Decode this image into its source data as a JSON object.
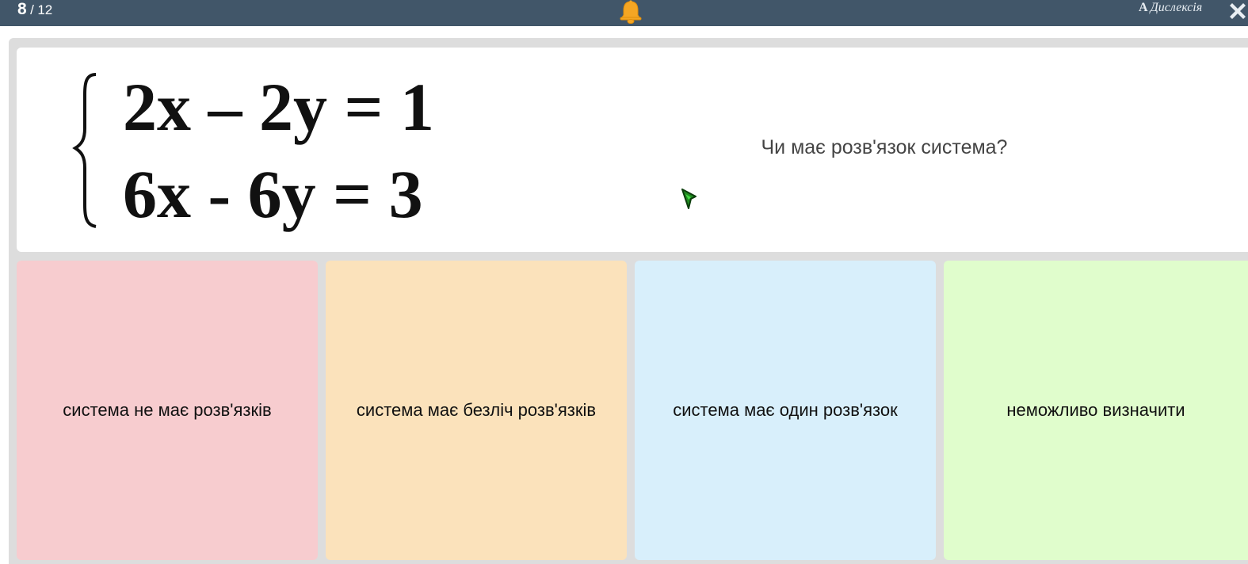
{
  "header": {
    "question_current": "8",
    "question_separator": "/",
    "question_total": "12",
    "dyslexia_letter": "A",
    "dyslexia_label": "Дислексія"
  },
  "question": {
    "equations": [
      {
        "text": "2x – 2y = 1"
      },
      {
        "text": "6x - 6y = 3"
      }
    ],
    "prompt": "Чи має розв'язок система?"
  },
  "answers": [
    {
      "label": "система не має розв'язків",
      "color": "#f7cccf"
    },
    {
      "label": "система має безліч розв'язків",
      "color": "#fbe2bb"
    },
    {
      "label": "система має один розв'язок",
      "color": "#d8effb"
    },
    {
      "label": "неможливо визначити",
      "color": "#e0fdcc"
    }
  ],
  "icons": {
    "bell": "bell-icon",
    "close": "close-icon",
    "cursor": "pointer-cursor-icon"
  },
  "colors": {
    "topbar": "#415669",
    "bell": "#f5a623",
    "stage": "#dddddd"
  }
}
